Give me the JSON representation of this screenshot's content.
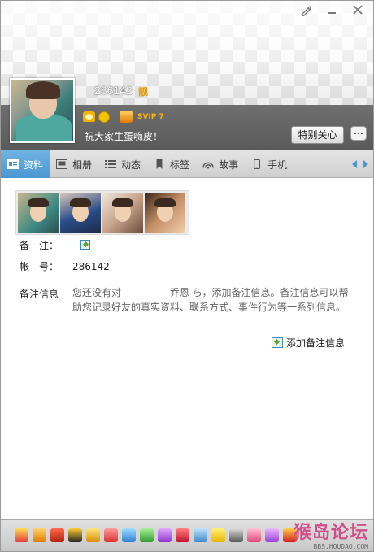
{
  "window": {
    "controls": [
      "skin-icon",
      "minimize-icon",
      "close-icon"
    ]
  },
  "profile": {
    "nickname": "286142",
    "vip_mark": "靓",
    "svip_label": "SVIP 7",
    "signature": "祝大家生蛋嗨皮！",
    "special_care_label": "特别关心"
  },
  "tabs": [
    {
      "label": "资料",
      "icon": "profile-card-icon",
      "active": true
    },
    {
      "label": "相册",
      "icon": "album-icon",
      "active": false
    },
    {
      "label": "动态",
      "icon": "feed-list-icon",
      "active": false
    },
    {
      "label": "标签",
      "icon": "bookmark-icon",
      "active": false
    },
    {
      "label": "故事",
      "icon": "story-signal-icon",
      "active": false
    },
    {
      "label": "手机",
      "icon": "phone-icon",
      "active": false
    }
  ],
  "info": {
    "remark_label": "备　注：",
    "remark_value": "-",
    "account_label": "帐　号：",
    "account_value": "286142",
    "remark_info_label": "备注信息",
    "remark_info_desc": "您还没有对　　　　　乔恩 ら，添加备注信息。备注信息可以帮助您记录好友的真实资料、联系方式、事件行为等一系列信息。",
    "add_remark_label": "添加备注信息"
  },
  "bottom": {
    "watermark_main": "猴岛论坛",
    "watermark_sub": "BBS.HOUDAO.COM"
  },
  "colors": {
    "tab_active": "#4a97d1",
    "band": "#5f5f5f",
    "watermark": "#d24e8a"
  }
}
